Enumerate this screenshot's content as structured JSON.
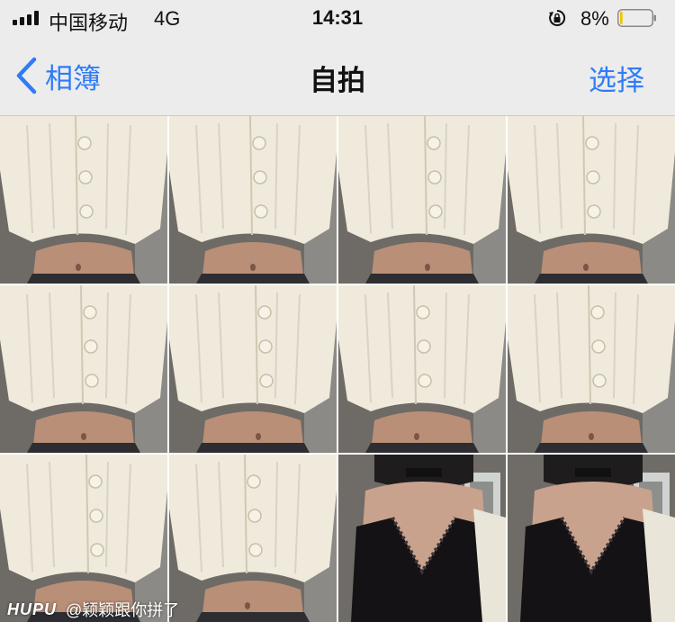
{
  "status_bar": {
    "carrier": "中国移动",
    "network": "4G",
    "time": "14:31",
    "battery_percent": "8%",
    "battery_level": 0.08,
    "icons": [
      "signal-icon",
      "orientation-lock-icon",
      "battery-icon"
    ]
  },
  "nav": {
    "back_label": "相簿",
    "title": "自拍",
    "select_label": "选择",
    "accent_color": "#2f7cf6"
  },
  "photos": [
    {
      "kind": "cream-cardigan"
    },
    {
      "kind": "cream-cardigan"
    },
    {
      "kind": "cream-cardigan"
    },
    {
      "kind": "cream-cardigan"
    },
    {
      "kind": "cream-cardigan"
    },
    {
      "kind": "cream-cardigan"
    },
    {
      "kind": "cream-cardigan"
    },
    {
      "kind": "cream-cardigan"
    },
    {
      "kind": "cream-cardigan"
    },
    {
      "kind": "cream-cardigan"
    },
    {
      "kind": "black-lace-top"
    },
    {
      "kind": "black-lace-top"
    }
  ],
  "watermark": {
    "logo": "HUPU",
    "handle": "@颖颖跟你拼了"
  }
}
